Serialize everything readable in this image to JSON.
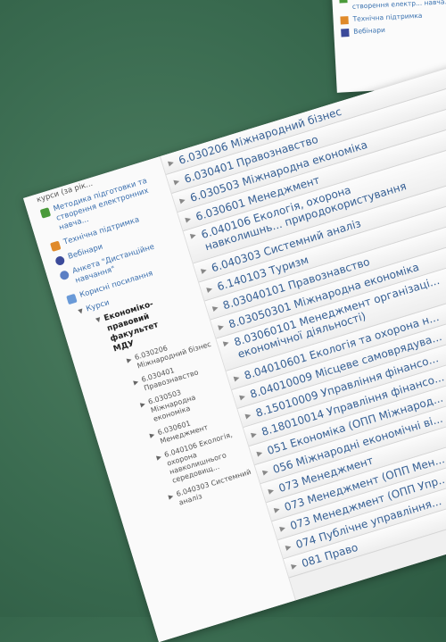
{
  "fragment": {
    "items": [
      {
        "label": "Методика підготов... створення електр... навча...",
        "icon": "doc-icon",
        "color": "#4a9a3a"
      },
      {
        "label": "Технічна підтримка",
        "icon": "support-icon",
        "color": "#e08a2a"
      },
      {
        "label": "Вебінари",
        "icon": "webinar-icon",
        "color": "#3b4a9a"
      }
    ]
  },
  "sidebar": {
    "top_cut": "курси (за рік...",
    "links": [
      {
        "label": "Методика підготовки та створення електронних навча...",
        "icon": "doc-icon",
        "color": "#4a9a3a"
      },
      {
        "label": "Технічна підтримка",
        "icon": "support-icon",
        "color": "#e08a2a"
      },
      {
        "label": "Вебінари",
        "icon": "webinar-icon",
        "color": "#3b4a9a"
      },
      {
        "label": "Анкета \"Дистанційне навчання\"",
        "icon": "form-icon",
        "color": "#5b7fc4"
      },
      {
        "label": "Корисні посилання",
        "icon": "links-icon",
        "color": "#6a9ad8"
      }
    ],
    "courses_label": "Курси",
    "faculty": "Економіко-правовий факультет МДУ",
    "subitems": [
      "6.030206 Міжнародний бізнес",
      "6.030401 Правознавство",
      "6.030503 Міжнародна економіка",
      "6.030601 Менеджмент",
      "6.040106 Екологія, охорона навколишнього середовищ...",
      "6.040303 Системний аналіз"
    ]
  },
  "specialties": [
    {
      "label": "6.030206 Міжнародний бізнес"
    },
    {
      "label": "6.030401 Правознавство"
    },
    {
      "label": "6.030503 Міжнародна економіка"
    },
    {
      "label": "6.030601 Менеджмент"
    },
    {
      "label": "6.040106 Екологія, охорона навколишнь... природокористування",
      "double": true
    },
    {
      "label": "6.040303 Системний аналіз"
    },
    {
      "label": "6.140103 Туризм"
    },
    {
      "label": "8.03040101 Правознавство"
    },
    {
      "label": "8.03050301 Міжнародна економіка"
    },
    {
      "label": "8.03060101 Менеджмент організаці... економічної діяльності)",
      "double": true
    },
    {
      "label": "8.04010601 Екологія та охорона н..."
    },
    {
      "label": "8.04010009 Місцеве самоврядува..."
    },
    {
      "label": "8.15010009 Управління фінансо..."
    },
    {
      "label": "8.18010014 Управління фінансо..."
    },
    {
      "label": "051 Економіка (ОПП Міжнарод..."
    },
    {
      "label": "056 Міжнародні економічні ві..."
    },
    {
      "label": "073 Менеджмент"
    },
    {
      "label": "073 Менеджмент (ОПП Мен..."
    },
    {
      "label": "073 Менеджмент (ОПП Упр..."
    },
    {
      "label": "074 Публічне управління..."
    },
    {
      "label": "081 Право"
    }
  ]
}
